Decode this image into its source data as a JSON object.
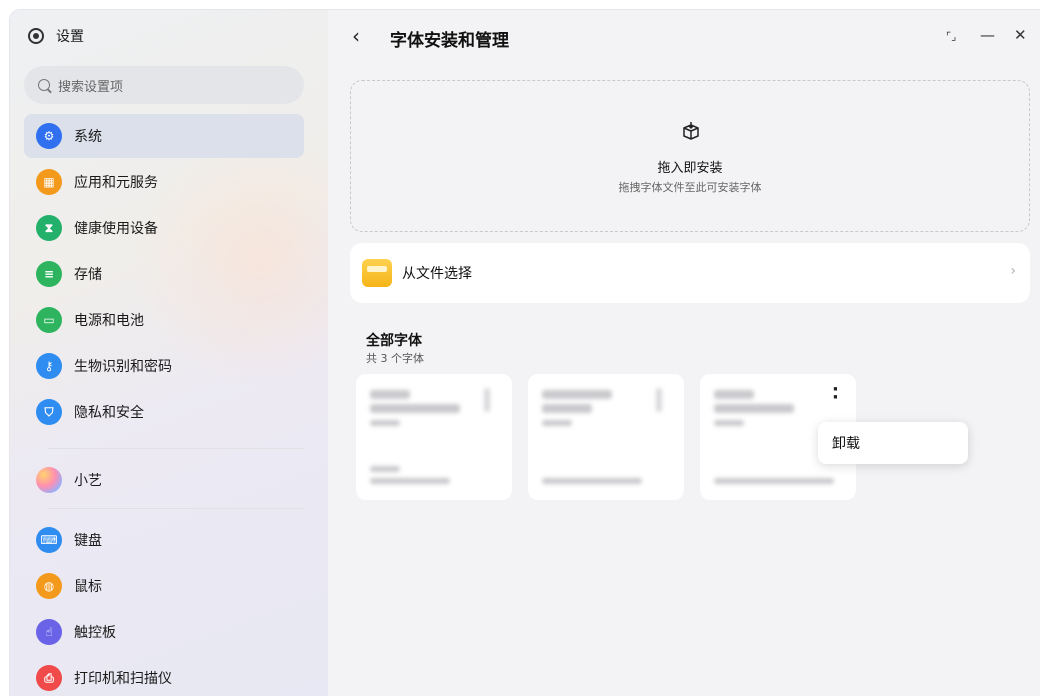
{
  "app": {
    "title": "设置"
  },
  "search": {
    "placeholder": "搜索设置项"
  },
  "sidebar": {
    "items": [
      {
        "label": "系统",
        "icon": "gear-icon",
        "color": "#2f6ff0",
        "active": true
      },
      {
        "label": "应用和元服务",
        "icon": "apps-icon",
        "color": "#f39a1c"
      },
      {
        "label": "健康使用设备",
        "icon": "hourglass-icon",
        "color": "#22b06a"
      },
      {
        "label": "存储",
        "icon": "storage-icon",
        "color": "#2eb45e"
      },
      {
        "label": "电源和电池",
        "icon": "battery-icon",
        "color": "#2eb45e"
      },
      {
        "label": "生物识别和密码",
        "icon": "key-icon",
        "color": "#2f8cf0"
      },
      {
        "label": "隐私和安全",
        "icon": "shield-icon",
        "color": "#2f8cf0"
      },
      {
        "label": "小艺",
        "icon": "assistant-icon",
        "color": "#b07cf0"
      },
      {
        "label": "键盘",
        "icon": "keyboard-icon",
        "color": "#2f8cf0"
      },
      {
        "label": "鼠标",
        "icon": "mouse-icon",
        "color": "#f39a1c"
      },
      {
        "label": "触控板",
        "icon": "touchpad-icon",
        "color": "#6a63e8"
      },
      {
        "label": "打印机和扫描仪",
        "icon": "printer-icon",
        "color": "#f04a4a"
      }
    ]
  },
  "main": {
    "title": "字体安装和管理",
    "dropzone": {
      "title": "拖入即安装",
      "subtitle": "拖拽字体文件至此可安装字体"
    },
    "file_select": {
      "label": "从文件选择"
    },
    "section": {
      "title": "全部字体",
      "count": "共 3 个字体"
    },
    "context_menu": {
      "uninstall": "卸载"
    }
  },
  "window_controls": {
    "restore": "⬚",
    "minimize": "—",
    "close": "✕"
  },
  "colors": {
    "accent": "#2f6ff0",
    "folder": "#f5b418"
  }
}
